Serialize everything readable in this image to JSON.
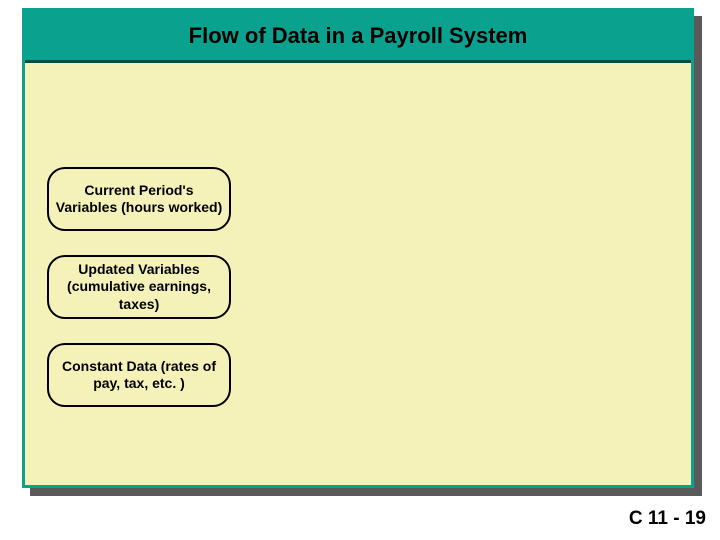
{
  "slide": {
    "title": "Flow of Data in a Payroll System",
    "nodes": [
      {
        "label": "Current Period's Variables (hours worked)"
      },
      {
        "label": "Updated Variables (cumulative earnings, taxes)"
      },
      {
        "label": "Constant Data (rates of pay, tax, etc. )"
      }
    ],
    "page_number": "C 11 - 19"
  }
}
